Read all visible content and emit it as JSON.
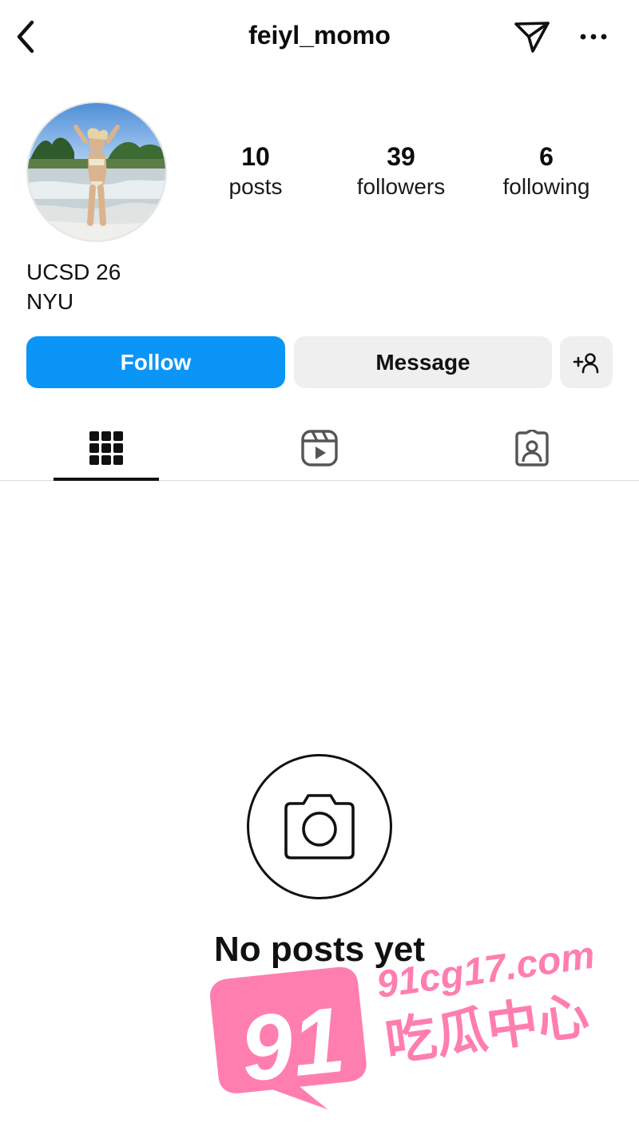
{
  "header": {
    "username": "feiyl_momo",
    "back_icon": "chevron-left-icon",
    "send_icon": "paper-plane-icon",
    "more_icon": "ellipsis-icon"
  },
  "profile": {
    "stats": [
      {
        "value": "10",
        "label": "posts"
      },
      {
        "value": "39",
        "label": "followers"
      },
      {
        "value": "6",
        "label": "following"
      }
    ],
    "bio": [
      "UCSD 26",
      "NYU"
    ]
  },
  "actions": {
    "follow_label": "Follow",
    "message_label": "Message",
    "add_user_icon": "add-user-icon"
  },
  "tabs": [
    {
      "icon": "grid-icon",
      "active": true
    },
    {
      "icon": "reels-icon",
      "active": false
    },
    {
      "icon": "tagged-icon",
      "active": false
    }
  ],
  "empty_state": {
    "title": "No posts yet",
    "icon": "camera-icon"
  },
  "watermark": {
    "number": "91",
    "domain": "91cg17.com",
    "chinese": "吃瓜中心"
  },
  "colors": {
    "follow_button": "#0a95f7",
    "secondary_button": "#efefef",
    "watermark_pink": "#ff7eb0",
    "text_primary": "#0b0b0b"
  }
}
